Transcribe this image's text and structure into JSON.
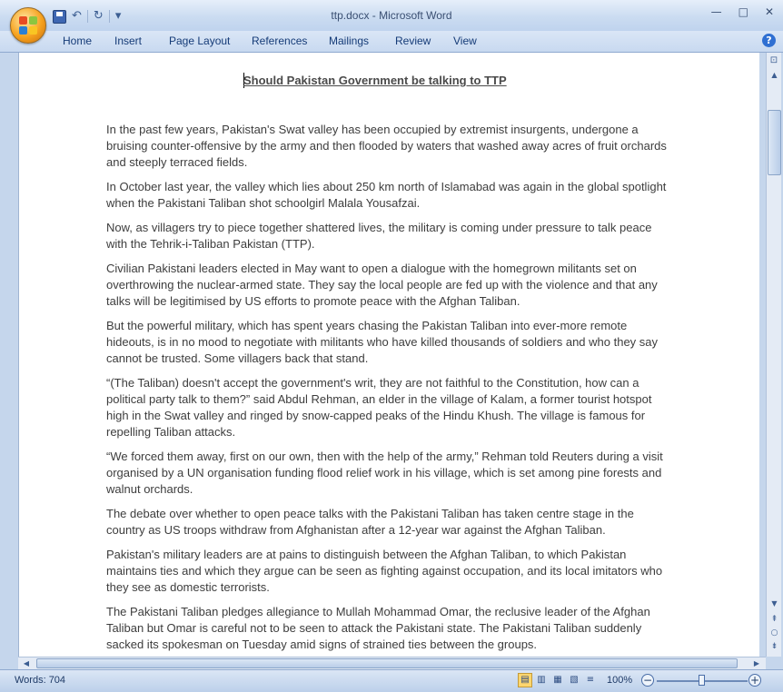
{
  "window": {
    "title": "ttp.docx - Microsoft Word",
    "minimize_glyph": "—",
    "maximize_glyph": "□",
    "close_glyph": "✕"
  },
  "quick_access": {
    "undo_glyph": "↶",
    "redo_glyph": "↻",
    "customize_glyph": "▾"
  },
  "office_logo_colors": [
    "#e84c22",
    "#8cc63f",
    "#2a7fd4",
    "#f9c623"
  ],
  "ribbon": {
    "tabs": [
      "Home",
      "Insert",
      "Page Layout",
      "References",
      "Mailings",
      "Review",
      "View"
    ],
    "help_glyph": "?"
  },
  "document": {
    "heading": "Should Pakistan Government be talking to TTP",
    "paragraphs": [
      "In the past few years, Pakistan's Swat valley has been occupied by extremist insurgents, undergone a bruising counter-offensive by the army and then flooded by waters that washed away acres of fruit orchards and steeply terraced fields.",
      "In October last year, the valley which lies about 250 km north of Islamabad was again in the global spotlight when the Pakistani Taliban shot schoolgirl Malala Yousafzai.",
      "Now, as villagers try to piece together shattered lives, the military is coming under pressure to talk peace with the Tehrik-i-Taliban Pakistan (TTP).",
      "Civilian Pakistani leaders elected in May want to open a dialogue with the homegrown militants set on overthrowing the nuclear-armed state. They say the local people are fed up with the violence and that any talks will be legitimised by US efforts to promote peace with the Afghan Taliban.",
      "But the powerful military, which has spent years chasing the Pakistan Taliban into ever-more remote hideouts, is in no mood to negotiate with militants who have killed thousands of soldiers and who they say cannot be trusted. Some villagers back that stand.",
      "“(The Taliban) doesn't accept the government's writ, they are not faithful to the Constitution, how can a political party talk to them?” said Abdul Rehman, an elder in the village of Kalam, a former tourist hotspot high in the Swat valley and ringed by snow-capped peaks of the Hindu Khush. The village is famous for repelling Taliban attacks.",
      "“We forced them away, first on our own, then with the help of the army,” Rehman told Reuters during a visit organised by a UN organisation funding flood relief work in his village, which is set among pine forests and walnut orchards.",
      "The debate over whether to open peace talks with the Pakistani Taliban has taken centre stage in the country as US troops withdraw from Afghanistan after a 12-year war against the Afghan Taliban.",
      "Pakistan's military leaders are at pains to distinguish between the Afghan Taliban, to which Pakistan maintains ties and which they argue can be seen as fighting against occupation, and its local imitators who they see as domestic terrorists.",
      "The Pakistani Taliban pledges allegiance to Mullah Mohammad Omar, the reclusive leader of the Afghan Taliban but Omar is careful not to be seen to attack the Pakistani state. The Pakistani Taliban suddenly sacked its spokesman on Tuesday amid signs of strained ties between the groups."
    ]
  },
  "scrollbars": {
    "up_glyph": "▲",
    "down_glyph": "▼",
    "left_glyph": "◀",
    "right_glyph": "▶",
    "prev_page_glyph": "⇞",
    "browse_object_glyph": "○",
    "next_page_glyph": "⇟",
    "ruler_glyph": "⊡"
  },
  "status": {
    "word_count": "Words: 704",
    "zoom": "100%",
    "zoom_fraction": 0.5,
    "view_glyphs": [
      "▤",
      "▥",
      "▦",
      "▧",
      "≡"
    ]
  }
}
